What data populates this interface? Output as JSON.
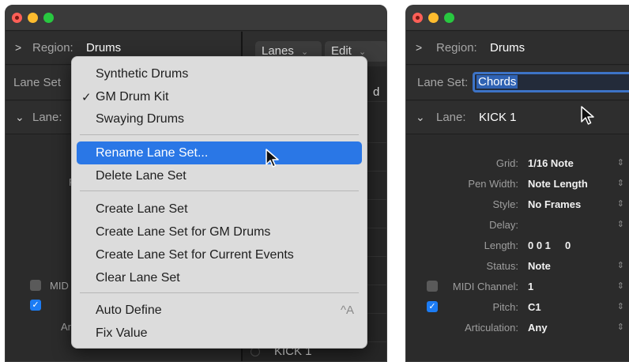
{
  "left_window": {
    "region_label": "Region:",
    "region_value": "Drums",
    "lane_set_label": "Lane Set",
    "lane_label": "Lane:",
    "lanes_button": "Lanes",
    "edit_button": "Edit",
    "partial_right_letter": "d",
    "partial_label_p": "P",
    "partial_label_mid": "MID",
    "partial_label_ar": "Ar",
    "bottom_lane": "KICK 1"
  },
  "menu": {
    "items": [
      {
        "label": "Synthetic Drums",
        "checked": false
      },
      {
        "label": "GM Drum Kit",
        "checked": true
      },
      {
        "label": "Swaying Drums",
        "checked": false
      }
    ],
    "actions_1": [
      "Rename Lane Set...",
      "Delete Lane Set"
    ],
    "highlighted": "Rename Lane Set...",
    "actions_2": [
      "Create Lane Set",
      "Create Lane Set for GM Drums",
      "Create Lane Set for Current Events",
      "Clear Lane Set"
    ],
    "actions_3": [
      {
        "label": "Auto Define",
        "shortcut": "^A"
      },
      {
        "label": "Fix Value",
        "shortcut": ""
      }
    ]
  },
  "right_window": {
    "region_label": "Region:",
    "region_value": "Drums",
    "lane_set_label": "Lane Set:",
    "lane_set_value": "Chords",
    "lane_label": "Lane:",
    "lane_value": "KICK 1",
    "properties": [
      {
        "label": "Grid:",
        "value": "1/16 Note",
        "stepper": true
      },
      {
        "label": "Pen Width:",
        "value": "Note Length",
        "stepper": true
      },
      {
        "label": "Style:",
        "value": "No Frames",
        "stepper": true
      },
      {
        "label": "Delay:",
        "value": "",
        "stepper": true
      },
      {
        "label": "Length:",
        "value": "0 0 1     0",
        "stepper": false
      },
      {
        "label": "Status:",
        "value": "Note",
        "stepper": true
      },
      {
        "label": "MIDI Channel:",
        "value": "1",
        "stepper": true,
        "checkbox": false
      },
      {
        "label": "Pitch:",
        "value": "C1",
        "stepper": true,
        "checkbox": true
      },
      {
        "label": "Articulation:",
        "value": "Any",
        "stepper": true
      }
    ]
  },
  "colors": {
    "accent": "#2a77e6",
    "checkbox_on": "#1c7cf4",
    "menu_bg": "#dcdcdc",
    "panel_bg": "#2b2b2b"
  }
}
